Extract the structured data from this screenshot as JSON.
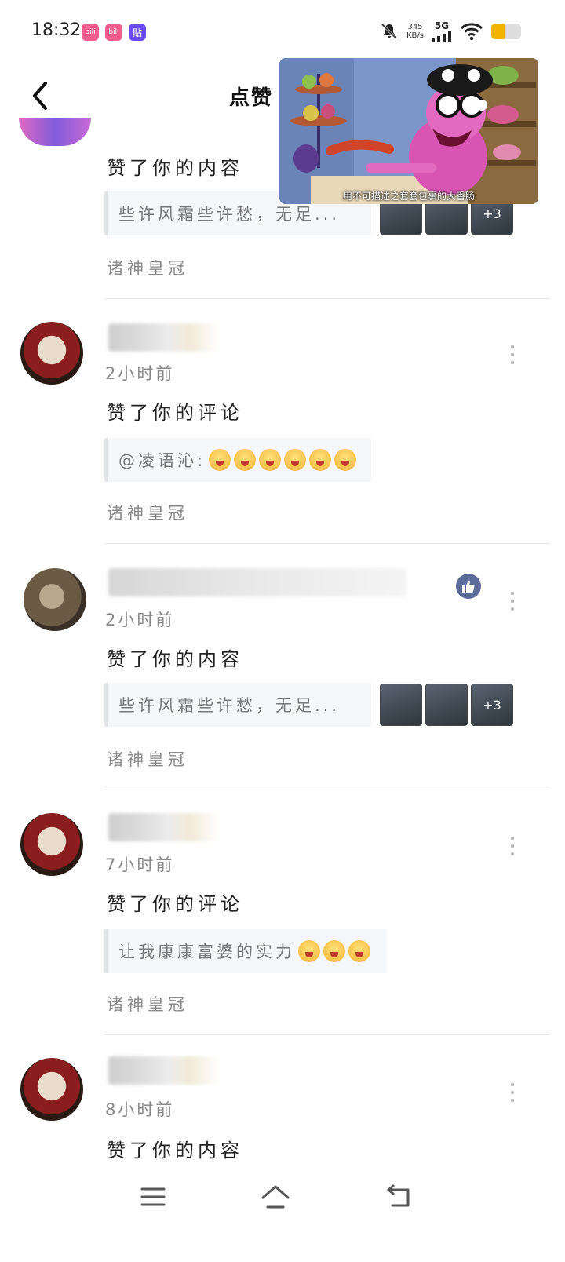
{
  "status_bar": {
    "time": "18:32",
    "net_speed_value": "345",
    "net_speed_unit": "KB/s",
    "network": "5G",
    "battery_level": 0.45,
    "app_icons": [
      "bilibili-icon",
      "bilibili-icon",
      "tieba-icon"
    ],
    "app_icon_text": [
      "bili",
      "bili",
      "贴"
    ]
  },
  "header": {
    "title": "点赞"
  },
  "pip_video": {
    "caption": "用不可描述之套套包裹的大香肠"
  },
  "items": [
    {
      "time": "",
      "action": "赞了你的内容",
      "quote": "些许风霜些许愁，无足...",
      "thumbs_more": "+3",
      "source": "诸神皇冠"
    },
    {
      "time": "2小时前",
      "action": "赞了你的评论",
      "quote": "@凌语沁:",
      "source": "诸神皇冠"
    },
    {
      "time": "2小时前",
      "action": "赞了你的内容",
      "quote": "些许风霜些许愁，无足...",
      "thumbs_more": "+3",
      "source": "诸神皇冠"
    },
    {
      "time": "7小时前",
      "action": "赞了你的评论",
      "quote": "让我康康富婆的实力",
      "source": "诸神皇冠"
    },
    {
      "time": "8小时前",
      "action": "赞了你的内容"
    }
  ],
  "colors": {
    "accent_like": "#5b6b9a",
    "battery": "#f6b400",
    "app_pink": "#f25d8e",
    "app_purple": "#6a4cf5"
  }
}
